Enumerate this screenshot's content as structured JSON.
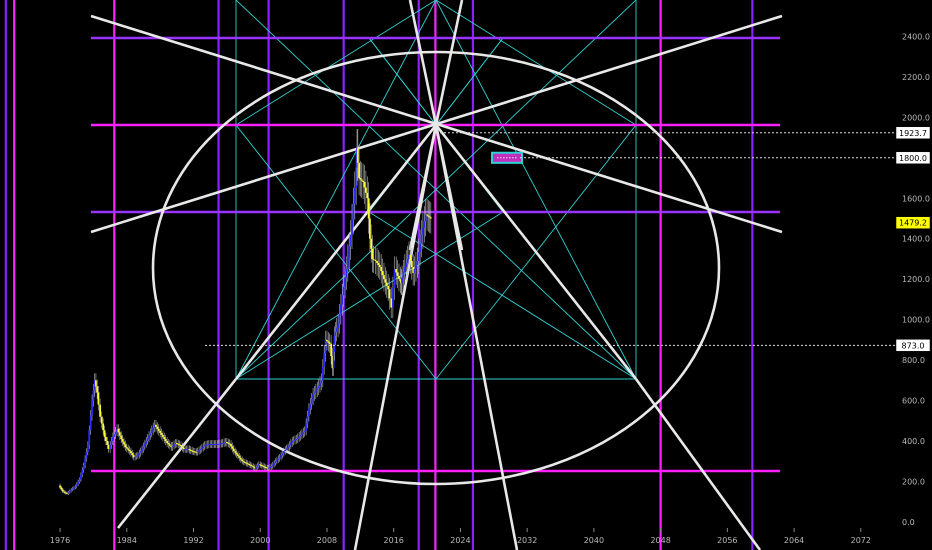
{
  "chart_data": {
    "type": "bar",
    "title": "",
    "xlabel": "",
    "ylabel": "",
    "x_ticks": [
      "1976",
      "1984",
      "1992",
      "2000",
      "2008",
      "2016",
      "2024",
      "2032",
      "2040",
      "2048",
      "2056",
      "2064",
      "2072"
    ],
    "y_ticks": [
      "0.0",
      "200.0",
      "400.0",
      "600.0",
      "800.0",
      "1000.0",
      "1200.0",
      "1400.0",
      "1600.0",
      "1800.0",
      "2000.0",
      "2200.0",
      "2400.0"
    ],
    "xlim": [
      1968.8,
      2075.5
    ],
    "ylim": [
      -30,
      2580
    ],
    "price_labels": [
      {
        "value": 1923.7,
        "text": "1923.7",
        "style": "box"
      },
      {
        "value": 1800.0,
        "text": "1800.0",
        "style": "box"
      },
      {
        "value": 1479.2,
        "text": "1479.2",
        "style": "highlight"
      },
      {
        "value": 873.0,
        "text": "873.0",
        "style": "box"
      }
    ],
    "price_series": {
      "name": "",
      "up_color": "#2b2bff",
      "down_color": "#ffff33",
      "points": [
        [
          1976.0,
          180
        ],
        [
          1976.5,
          150
        ],
        [
          1977.0,
          140
        ],
        [
          1977.5,
          160
        ],
        [
          1978.0,
          175
        ],
        [
          1978.5,
          210
        ],
        [
          1979.0,
          280
        ],
        [
          1979.5,
          380
        ],
        [
          1980.0,
          600
        ],
        [
          1980.3,
          700
        ],
        [
          1980.6,
          640
        ],
        [
          1981.0,
          520
        ],
        [
          1981.5,
          420
        ],
        [
          1982.0,
          360
        ],
        [
          1982.5,
          420
        ],
        [
          1983.0,
          460
        ],
        [
          1983.5,
          410
        ],
        [
          1984.0,
          370
        ],
        [
          1984.5,
          350
        ],
        [
          1985.0,
          320
        ],
        [
          1985.5,
          330
        ],
        [
          1986.0,
          360
        ],
        [
          1986.5,
          400
        ],
        [
          1987.0,
          440
        ],
        [
          1987.5,
          480
        ],
        [
          1988.0,
          450
        ],
        [
          1988.5,
          420
        ],
        [
          1989.0,
          390
        ],
        [
          1989.5,
          370
        ],
        [
          1990.0,
          390
        ],
        [
          1990.5,
          380
        ],
        [
          1991.0,
          360
        ],
        [
          1991.5,
          360
        ],
        [
          1992.0,
          350
        ],
        [
          1992.5,
          345
        ],
        [
          1993.0,
          360
        ],
        [
          1993.5,
          380
        ],
        [
          1994.0,
          385
        ],
        [
          1994.5,
          385
        ],
        [
          1995.0,
          385
        ],
        [
          1995.5,
          388
        ],
        [
          1996.0,
          395
        ],
        [
          1996.5,
          385
        ],
        [
          1997.0,
          350
        ],
        [
          1997.5,
          325
        ],
        [
          1998.0,
          300
        ],
        [
          1998.5,
          290
        ],
        [
          1999.0,
          280
        ],
        [
          1999.5,
          265
        ],
        [
          2000.0,
          285
        ],
        [
          2000.5,
          275
        ],
        [
          2001.0,
          265
        ],
        [
          2001.5,
          275
        ],
        [
          2002.0,
          300
        ],
        [
          2002.5,
          320
        ],
        [
          2003.0,
          350
        ],
        [
          2003.5,
          370
        ],
        [
          2004.0,
          400
        ],
        [
          2004.5,
          410
        ],
        [
          2005.0,
          430
        ],
        [
          2005.5,
          450
        ],
        [
          2006.0,
          560
        ],
        [
          2006.5,
          630
        ],
        [
          2007.0,
          660
        ],
        [
          2007.5,
          700
        ],
        [
          2008.0,
          900
        ],
        [
          2008.5,
          880
        ],
        [
          2008.8,
          760
        ],
        [
          2009.0,
          920
        ],
        [
          2009.5,
          980
        ],
        [
          2010.0,
          1120
        ],
        [
          2010.5,
          1250
        ],
        [
          2011.0,
          1420
        ],
        [
          2011.5,
          1650
        ],
        [
          2011.7,
          1850
        ],
        [
          2012.0,
          1700
        ],
        [
          2012.5,
          1680
        ],
        [
          2013.0,
          1600
        ],
        [
          2013.3,
          1400
        ],
        [
          2013.6,
          1300
        ],
        [
          2014.0,
          1290
        ],
        [
          2014.5,
          1260
        ],
        [
          2015.0,
          1200
        ],
        [
          2015.5,
          1150
        ],
        [
          2015.9,
          1060
        ],
        [
          2016.3,
          1250
        ],
        [
          2016.8,
          1200
        ],
        [
          2017.0,
          1180
        ],
        [
          2017.5,
          1260
        ],
        [
          2018.0,
          1320
        ],
        [
          2018.5,
          1230
        ],
        [
          2019.0,
          1290
        ],
        [
          2019.5,
          1420
        ],
        [
          2020.0,
          1520
        ],
        [
          2020.6,
          1500
        ]
      ]
    },
    "geometry_overlay": {
      "colors": {
        "circle": "#e8e8e8",
        "rays": "#e8e8e8",
        "thin_lines": "#2fd0d0",
        "h_magenta": "#ff20ff",
        "h_purple": "#9a33ff",
        "v_magenta": "#ff20ff",
        "v_purple": "#8a22ff",
        "highlight_label": "#ffff00",
        "target_box": "#2fd0d0",
        "target_fill": "#c02fc0"
      }
    }
  }
}
